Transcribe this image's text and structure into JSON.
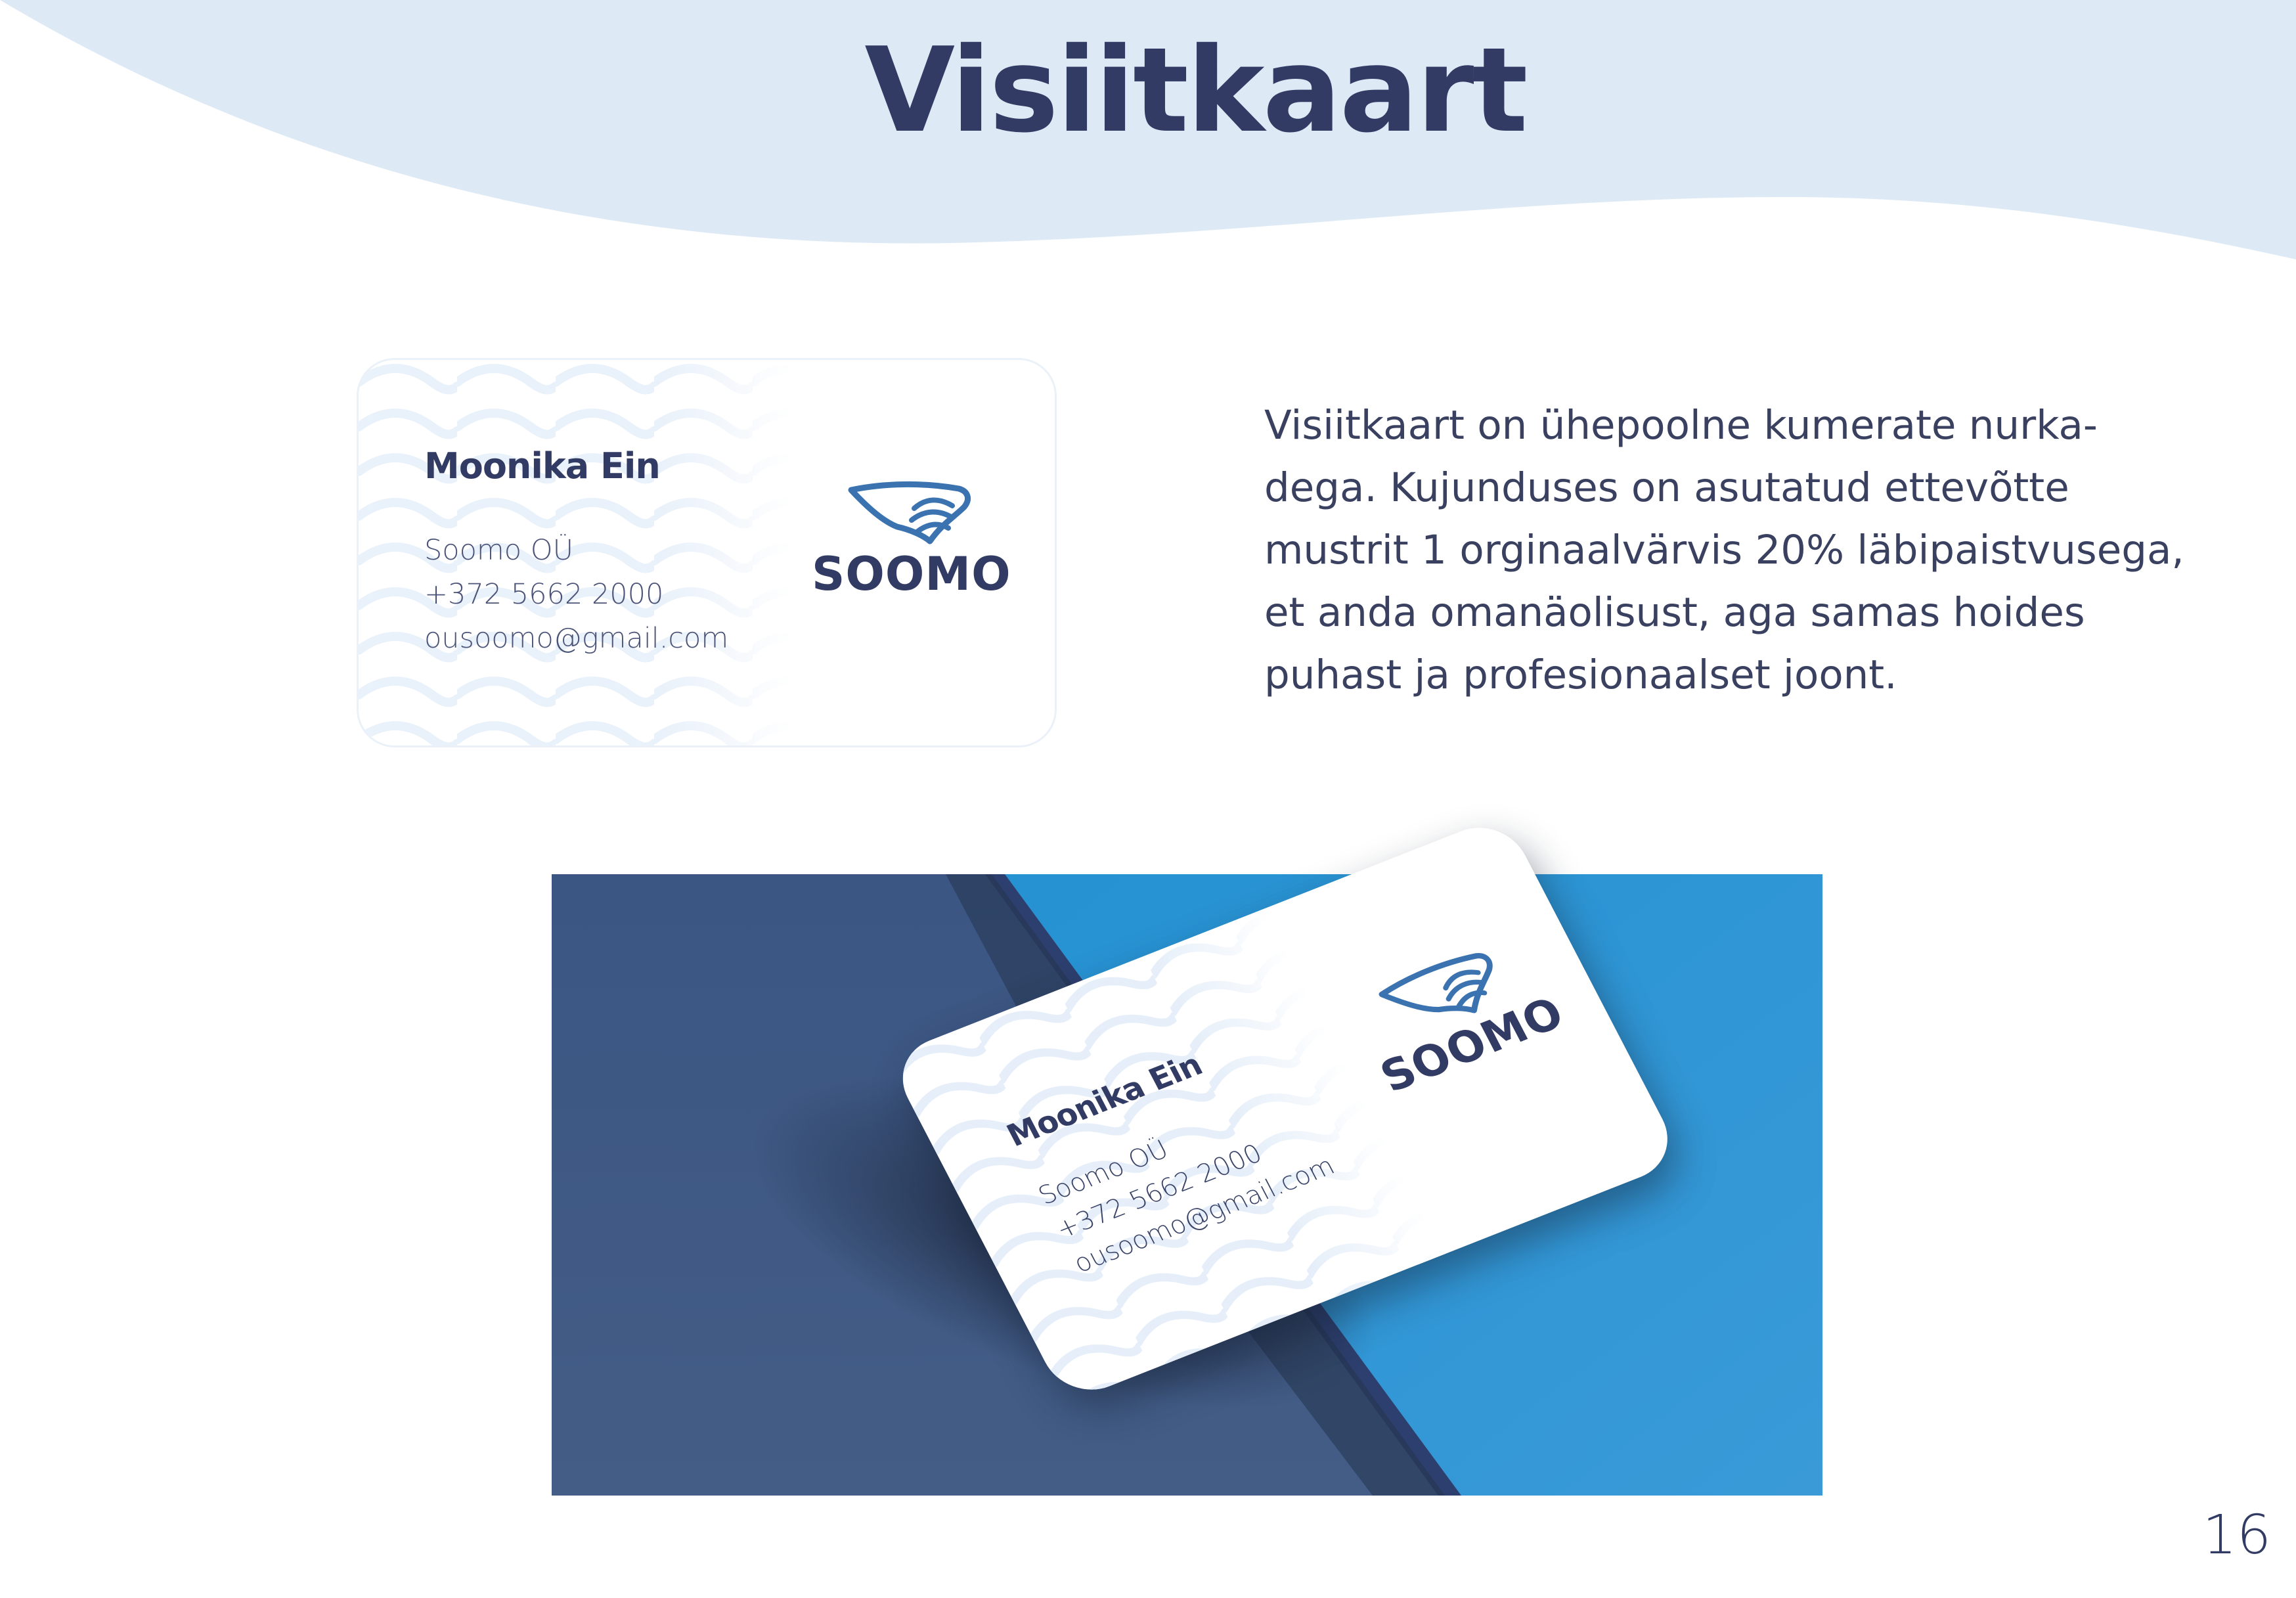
{
  "header": {
    "title": "Visiitkaart"
  },
  "card": {
    "name": "Moonika Ein",
    "company": "Soomo OÜ",
    "phone": "+372 5662 2000",
    "email": "ousoomo@gmail.com",
    "logo_text": "SOOMO"
  },
  "description": {
    "text": "Visiitkaart on ühepoolne kumerate nurka-dega. Kujunduses on asutatud ettevõtte mustrit 1 orginaalvärvis 20% läbipaistvusega, et anda omanäolisust, aga samas hoides puhast ja profesionaalset joont."
  },
  "mockup": {
    "card_name": "Moonika Ein",
    "card_company": "Soomo OÜ",
    "card_phone": "+372 5662 2000",
    "card_email": "ousoomo@gmail.com",
    "card_logo_text": "SOOMO"
  },
  "footer": {
    "page_number": "16"
  },
  "colors": {
    "title": "#323b64",
    "header_wave": "#ddeaf6",
    "logo_mark": "#3b73b0",
    "mockup_dark": "#3f5a85",
    "mockup_light": "#2596d6"
  },
  "icons": {
    "logo": "soomo-wave-logo-icon"
  }
}
